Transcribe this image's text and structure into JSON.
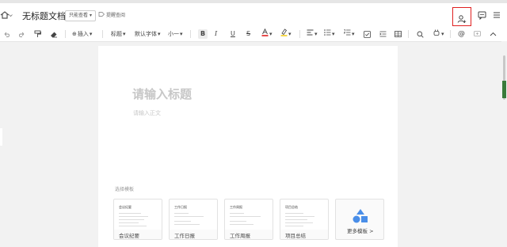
{
  "header": {
    "doc_title": "无标题文档",
    "readonly_label": "只能查看",
    "remind_label": "提醒查阅"
  },
  "toolbar": {
    "insert_label": "插入",
    "heading_label": "标题",
    "font_label": "默认字体",
    "size_label": "小一"
  },
  "editor": {
    "title_placeholder": "请输入标题",
    "body_placeholder": "请输入正文"
  },
  "templates": {
    "section_label": "选择模板",
    "cards": [
      {
        "label": "会议纪要",
        "thumb_title": "会议纪要"
      },
      {
        "label": "工作日报",
        "thumb_title": "工作日报"
      },
      {
        "label": "工作周报",
        "thumb_title": "工作周报"
      },
      {
        "label": "项目总结",
        "thumb_title": "项目总结"
      }
    ],
    "more_label": "更多模板 >"
  },
  "colors": {
    "highlight_border": "#e02020",
    "font_color_bar": "#e02020",
    "highlight_bar": "#f5d020",
    "more_shape": "#4a8ee8"
  }
}
